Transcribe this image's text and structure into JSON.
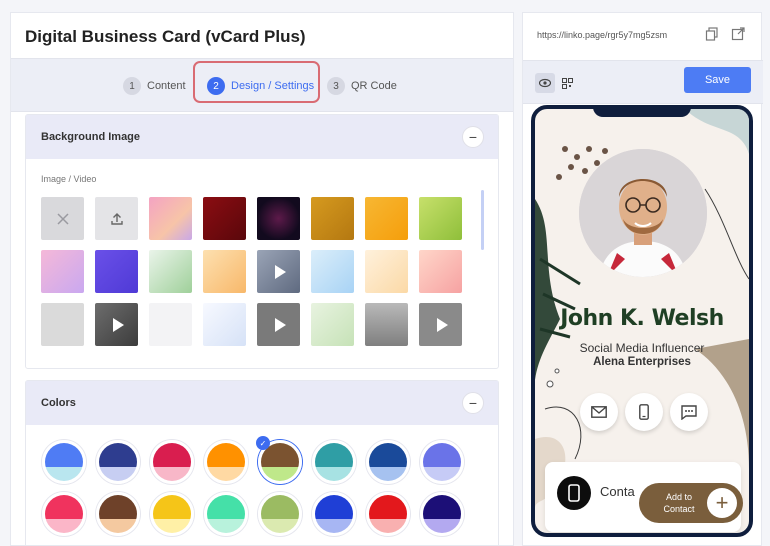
{
  "page_title": "Digital Business Card (vCard Plus)",
  "steps": [
    {
      "num": "1",
      "label": "Content"
    },
    {
      "num": "2",
      "label": "Design / Settings"
    },
    {
      "num": "3",
      "label": "QR Code"
    }
  ],
  "background_section": {
    "title": "Background Image",
    "collapse_symbol": "−",
    "sublabel": "Image / Video",
    "thumbs": [
      {
        "kind": "remove-icon",
        "bg": "#d9d9dc"
      },
      {
        "kind": "upload-icon",
        "bg": "#e4e4e7"
      },
      {
        "kind": "image",
        "bg": "linear-gradient(135deg,#f4a3c3,#f7c4a8 60%,#c9a8e8)"
      },
      {
        "kind": "image",
        "bg": "linear-gradient(135deg,#8b0d12,#5a070b)"
      },
      {
        "kind": "image",
        "bg": "radial-gradient(circle,#5d1a4a,#120a1e 70%)"
      },
      {
        "kind": "image",
        "bg": "linear-gradient(135deg,#d69a1f,#b47811)"
      },
      {
        "kind": "image",
        "bg": "linear-gradient(135deg,#f7b733,#f59e0b)"
      },
      {
        "kind": "image",
        "bg": "linear-gradient(135deg,#c7e06b,#8fbf3a)"
      },
      {
        "kind": "image",
        "bg": "linear-gradient(135deg,#f5b8d8,#c9a8f0)"
      },
      {
        "kind": "image",
        "bg": "linear-gradient(135deg,#6a50e8,#4f3ad6)"
      },
      {
        "kind": "image",
        "bg": "linear-gradient(135deg,#eaf4ea,#9fd09a)"
      },
      {
        "kind": "image",
        "bg": "linear-gradient(135deg,#fde0b0,#f8b86a)"
      },
      {
        "kind": "video",
        "bg": "linear-gradient(135deg,#9aa4b6,#5f6a80)"
      },
      {
        "kind": "image",
        "bg": "linear-gradient(135deg,#dbeefa,#a8d3f5)"
      },
      {
        "kind": "image",
        "bg": "linear-gradient(135deg,#fff1dc,#fbd9a6)"
      },
      {
        "kind": "image",
        "bg": "linear-gradient(135deg,#ffd6c9,#f6a2a2)"
      },
      {
        "kind": "image",
        "bg": "#dadada"
      },
      {
        "kind": "video",
        "bg": "linear-gradient(135deg,#6d6d6d,#3c3c3c)"
      },
      {
        "kind": "image",
        "bg": "#f3f3f5"
      },
      {
        "kind": "image",
        "bg": "linear-gradient(135deg,#f7f9ff,#d6e2f7)"
      },
      {
        "kind": "video",
        "bg": "#7a7a7a"
      },
      {
        "kind": "image",
        "bg": "linear-gradient(135deg,#e8f3e0,#c6e2b7)"
      },
      {
        "kind": "image",
        "bg": "linear-gradient(180deg,#b9b9b9,#7f7f7f)"
      },
      {
        "kind": "video",
        "bg": "#8a8a8a"
      }
    ]
  },
  "colors_section": {
    "title": "Colors",
    "collapse_symbol": "−",
    "selected_check": "✓",
    "swatches": [
      {
        "top": "#4f7cf4",
        "bottom": "#b9e6ef"
      },
      {
        "top": "#2e3d8f",
        "bottom": "#c7cef2"
      },
      {
        "top": "#d91e4f",
        "bottom": "#f8b7c8"
      },
      {
        "top": "#ff9100",
        "bottom": "#ffd9a3"
      },
      {
        "top": "#7b5330",
        "bottom": "#bfe88a",
        "selected": true
      },
      {
        "top": "#2f9ea5",
        "bottom": "#a7e2e3"
      },
      {
        "top": "#1a4a9a",
        "bottom": "#a6c2f0"
      },
      {
        "top": "#6a73e8",
        "bottom": "#c6cbf6"
      },
      {
        "top": "#f0335e",
        "bottom": "#fbb6c8"
      },
      {
        "top": "#6e4129",
        "bottom": "#f4c9a0"
      },
      {
        "top": "#f5c518",
        "bottom": "#fff0a6"
      },
      {
        "top": "#45e0a8",
        "bottom": "#b8f2dc"
      },
      {
        "top": "#9bbb62",
        "bottom": "#dbeab0"
      },
      {
        "top": "#1f3fd6",
        "bottom": "#a7b6f3"
      },
      {
        "top": "#e3181c",
        "bottom": "#f9b0b0"
      },
      {
        "top": "#1c0f77",
        "bottom": "#b3a9f0"
      }
    ]
  },
  "preview": {
    "url": "https://linko.page/rgr5y7mg5zsm",
    "save_label": "Save",
    "card": {
      "name": "John K. Welsh",
      "role": "Social Media Influencer",
      "company": "Alena Enterprises",
      "contact_label": "Conta",
      "add_to_contact": "Add to Contact",
      "plus": "+",
      "accent": "#7a5e3c",
      "name_color": "#1f3f24"
    }
  }
}
